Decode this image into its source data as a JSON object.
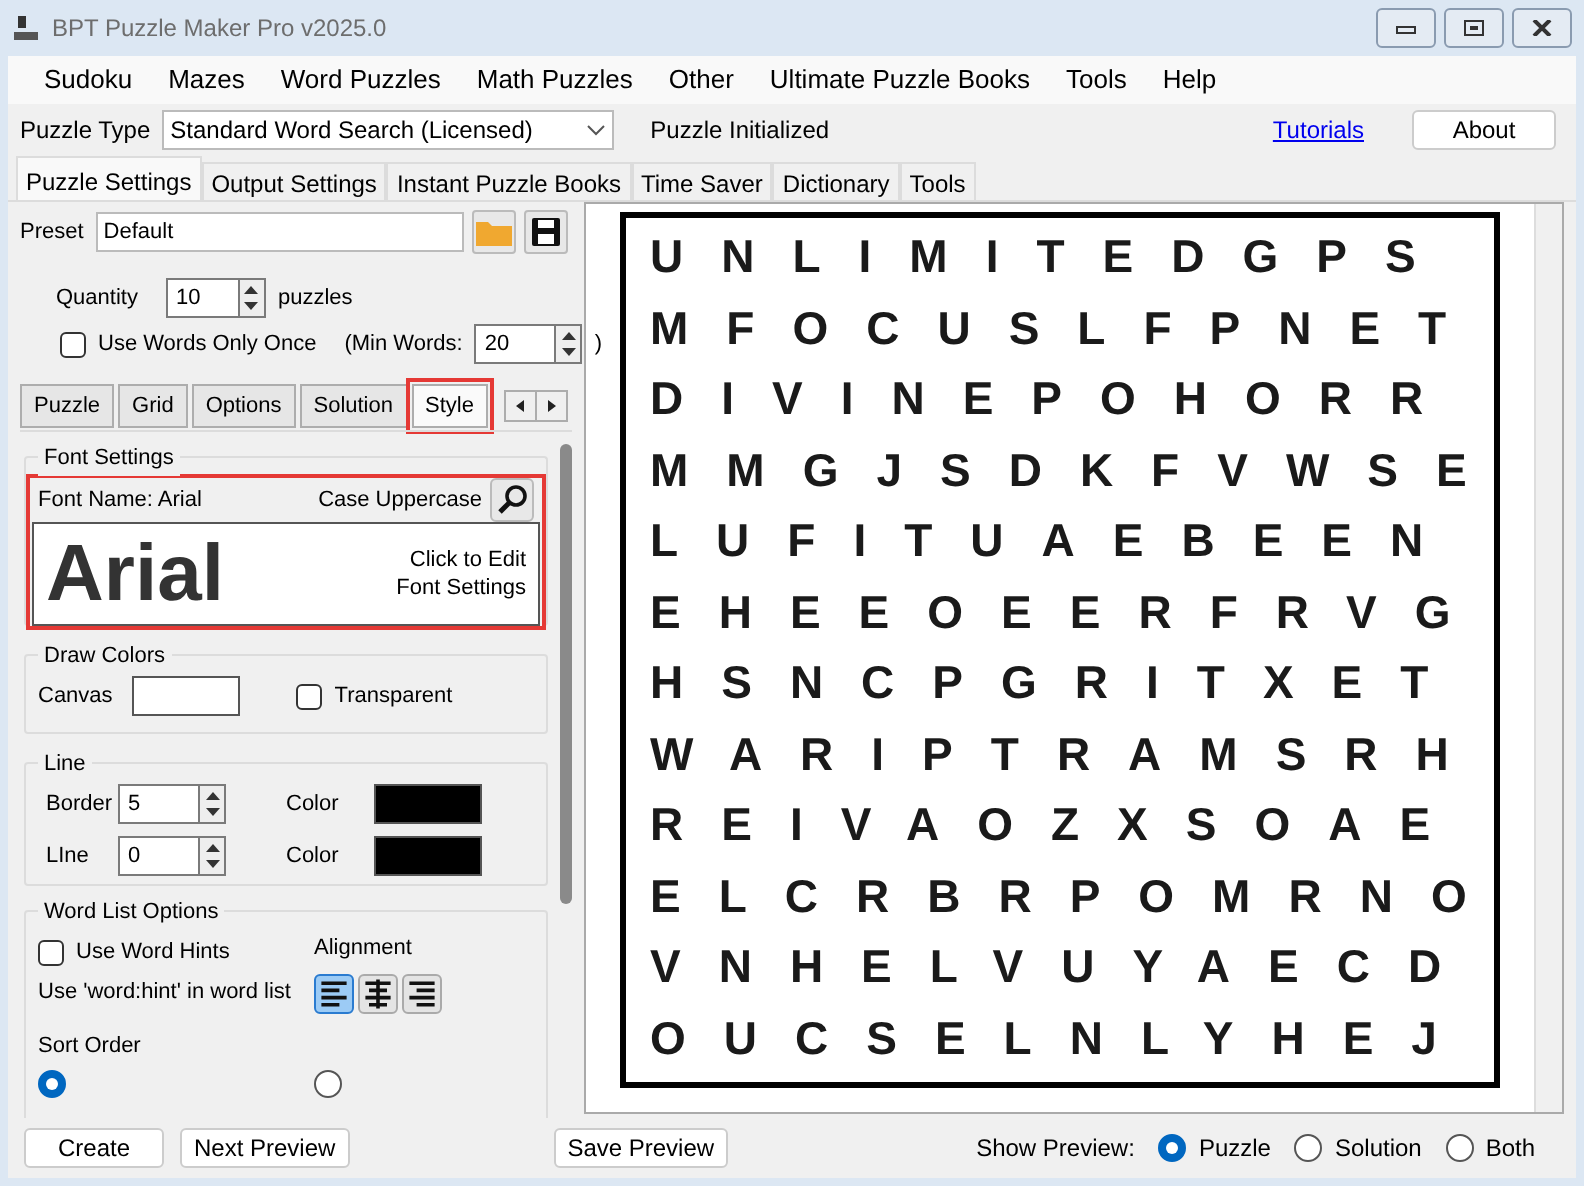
{
  "window": {
    "title": "BPT Puzzle Maker Pro v2025.0"
  },
  "menu": [
    "Sudoku",
    "Mazes",
    "Word Puzzles",
    "Math Puzzles",
    "Other",
    "Ultimate Puzzle Books",
    "Tools",
    "Help"
  ],
  "toolbar": {
    "puzzle_type_label": "Puzzle Type",
    "puzzle_type": "Standard Word Search (Licensed)",
    "status": "Puzzle Initialized",
    "link": "Tutorials",
    "about": "About"
  },
  "tabs": [
    {
      "label": "Puzzle Settings",
      "selected": true
    },
    {
      "label": "Output Settings",
      "selected": false
    },
    {
      "label": "Instant Puzzle Books",
      "selected": false
    },
    {
      "label": "Time Saver",
      "selected": false
    },
    {
      "label": "Dictionary",
      "selected": false
    },
    {
      "label": "Tools",
      "selected": false
    }
  ],
  "preset": {
    "label": "Preset",
    "value": "Default"
  },
  "quantity": {
    "label": "Quantity",
    "value": "10",
    "unit": "puzzles"
  },
  "use_words_once": {
    "label": "Use Words Only Once",
    "checked": false
  },
  "min_words": {
    "label": "(Min Words:",
    "value": "20",
    "close": ")"
  },
  "subtabs": [
    {
      "label": "Puzzle",
      "selected": false,
      "highlighted": false
    },
    {
      "label": "Grid",
      "selected": false,
      "highlighted": false
    },
    {
      "label": "Options",
      "selected": false,
      "highlighted": false
    },
    {
      "label": "Solution",
      "selected": false,
      "highlighted": false
    },
    {
      "label": "Style",
      "selected": true,
      "highlighted": true
    }
  ],
  "font_settings": {
    "title": "Font Settings",
    "font_name": "Font Name: Arial",
    "case": "Case Uppercase",
    "sample": "Arial",
    "hint": "Click to Edit Font Settings",
    "highlighted": true
  },
  "draw_colors": {
    "title": "Draw Colors",
    "canvas_label": "Canvas",
    "transparent": {
      "label": "Transparent",
      "checked": false
    }
  },
  "line": {
    "title": "Line",
    "rows": [
      {
        "label": "Border",
        "value": "5",
        "color_label": "Color"
      },
      {
        "label": "LIne",
        "value": "0",
        "color_label": "Color"
      }
    ]
  },
  "word_list_options": {
    "title": "Word List Options",
    "hints": {
      "label": "Use Word Hints",
      "checked": false
    },
    "hint_note": "Use 'word:hint' in word list",
    "alignment_label": "Alignment",
    "alignments": [
      {
        "kind": "left",
        "selected": true
      },
      {
        "kind": "center",
        "selected": false
      },
      {
        "kind": "right",
        "selected": false
      }
    ],
    "sort_label": "Sort Order",
    "sort_options": [
      {
        "selected": true
      },
      {
        "selected": false
      }
    ]
  },
  "grid": [
    "UNLIMITEDGPS",
    "MFOCUSLFPNET",
    "DIVINEPOHORR",
    "MMGJSDKFVWSE",
    "LUFITUAEBEEN",
    "EHEEOEERFRVG",
    "HSNCPGRITXET",
    "WARIPTRAMSRH",
    "REIVAOZXSOAE",
    "ELCRBRPOMRNO",
    "VNHELVUYAECD",
    "OUCSELNLYHEJ"
  ],
  "bottom": {
    "buttons": [
      "Create",
      "Next Preview"
    ],
    "save": "Save Preview",
    "show_label": "Show Preview:",
    "options": [
      {
        "label": "Puzzle",
        "selected": true
      },
      {
        "label": "Solution",
        "selected": false
      },
      {
        "label": "Both",
        "selected": false
      }
    ]
  }
}
